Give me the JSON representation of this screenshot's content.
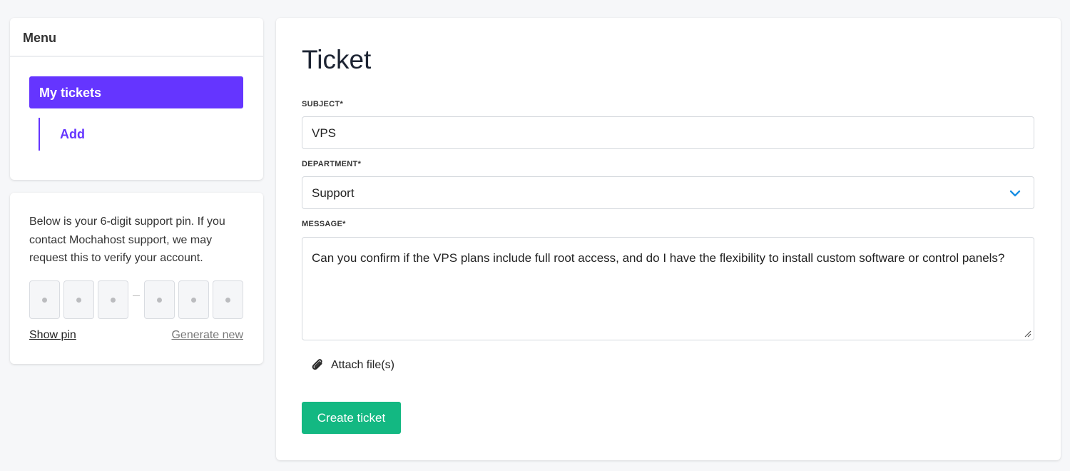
{
  "menu": {
    "header": "Menu",
    "items": [
      {
        "label": "My tickets",
        "active": true
      },
      {
        "label": "Add",
        "active": false
      }
    ]
  },
  "pin": {
    "description": "Below is your 6-digit support pin. If you contact Mochahost support, we may request this to verify your account.",
    "digits": [
      "•",
      "•",
      "•",
      "•",
      "•",
      "•"
    ],
    "show_label": "Show pin",
    "generate_label": "Generate new"
  },
  "ticket": {
    "title": "Ticket",
    "subject": {
      "label": "SUBJECT*",
      "value": "VPS"
    },
    "department": {
      "label": "DEPARTMENT*",
      "value": "Support"
    },
    "message": {
      "label": "MESSAGE*",
      "value": "Can you confirm if the VPS plans include full root access, and do I have the flexibility to install custom software or control panels?"
    },
    "attach_label": "Attach file(s)",
    "submit_label": "Create ticket"
  },
  "colors": {
    "accent": "#6535ff",
    "submit": "#13b882",
    "chevron": "#1a8fe3"
  },
  "icons": {
    "department_dropdown": "chevron-down-icon",
    "attach": "paperclip-icon",
    "textarea_resize": "resize-handle-icon"
  }
}
